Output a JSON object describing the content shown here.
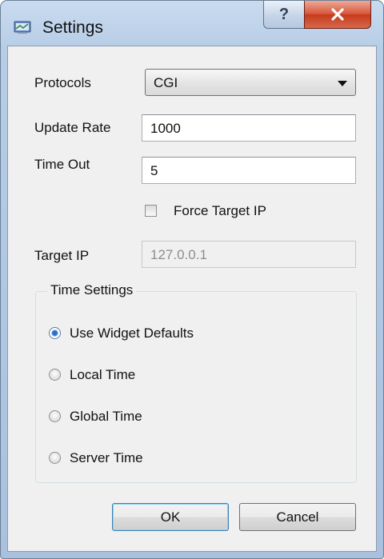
{
  "window": {
    "title": "Settings",
    "help_label": "?",
    "close_label": "✕"
  },
  "form": {
    "protocols_label": "Protocols",
    "protocols_value": "CGI",
    "update_rate_label": "Update Rate",
    "update_rate_value": "1000",
    "time_out_label": "Time Out",
    "time_out_value": "5",
    "force_target_ip_label": "Force Target IP",
    "force_target_ip_checked": false,
    "target_ip_label": "Target IP",
    "target_ip_value": "127.0.0.1"
  },
  "time_settings": {
    "title": "Time Settings",
    "options": [
      {
        "label": "Use Widget Defaults",
        "checked": true
      },
      {
        "label": "Local Time",
        "checked": false
      },
      {
        "label": "Global Time",
        "checked": false
      },
      {
        "label": "Server Time",
        "checked": false
      }
    ]
  },
  "buttons": {
    "ok_label": "OK",
    "cancel_label": "Cancel"
  }
}
